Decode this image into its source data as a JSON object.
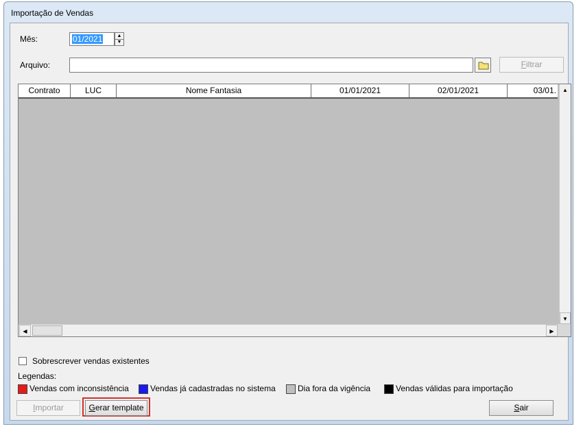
{
  "window": {
    "title": "Importação de Vendas"
  },
  "form": {
    "month_label": "Mês:",
    "month_value": "01/2021",
    "file_label": "Arquivo:",
    "file_value": "",
    "filter_button": {
      "mnemonic": "F",
      "rest": "iltrar"
    }
  },
  "grid": {
    "columns": [
      "Contrato",
      "LUC",
      "Nome Fantasia",
      "01/01/2021",
      "02/01/2021",
      "03/01."
    ],
    "rows": []
  },
  "options": {
    "overwrite_label": "Sobrescrever vendas existentes",
    "overwrite_checked": false
  },
  "legend": {
    "title": "Legendas:",
    "items": [
      {
        "label": "Vendas com inconsistência",
        "color": "#e51a1a"
      },
      {
        "label": "Vendas já cadastradas no sistema",
        "color": "#1a1aee"
      },
      {
        "label": "Dia fora da vigência",
        "color": "#bfbfbf"
      },
      {
        "label": "Vendas válidas para importação",
        "color": "#000000"
      }
    ]
  },
  "actions": {
    "import": {
      "mnemonic": "I",
      "rest": "mportar"
    },
    "generate_template": {
      "mnemonic": "G",
      "rest": "erar template"
    },
    "exit": {
      "mnemonic": "S",
      "rest": "air"
    }
  }
}
